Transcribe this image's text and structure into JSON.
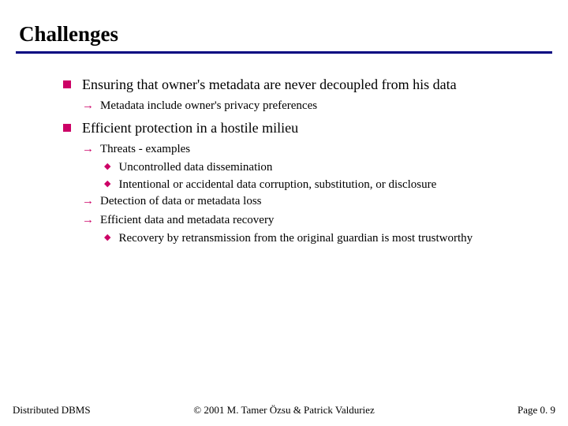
{
  "title": "Challenges",
  "b1": {
    "text": "Ensuring that owner's metadata are never decoupled from his data",
    "sub1": "Metadata include owner's privacy preferences"
  },
  "b2": {
    "text": "Efficient protection in a hostile milieu",
    "s1": {
      "text": "Threats - examples",
      "d1": "Uncontrolled data dissemination",
      "d2": "Intentional or accidental data corruption, substitution, or disclosure"
    },
    "s2": "Detection of data or metadata loss",
    "s3": {
      "text": "Efficient data and metadata recovery",
      "d1": "Recovery by retransmission from the original guardian is most trustworthy"
    }
  },
  "footer": {
    "left": "Distributed DBMS",
    "center": "© 2001 M. Tamer Özsu & Patrick Valduriez",
    "right": "Page 0. 9"
  }
}
